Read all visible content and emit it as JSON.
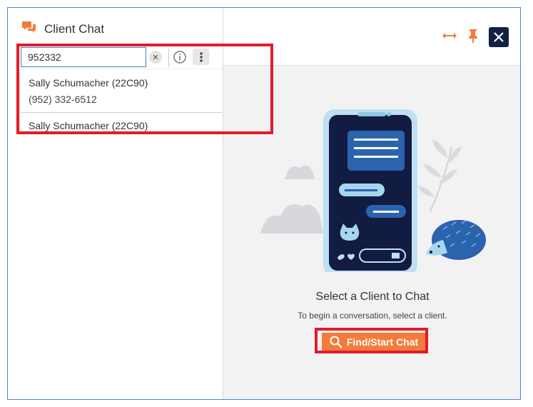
{
  "panel": {
    "title": "Client Chat"
  },
  "search": {
    "value": "952332"
  },
  "results": [
    {
      "name": "Sally Schumacher (22C90)",
      "phone": "(952) 332-6512"
    },
    {
      "name": "Sally Schumacher (22C90)",
      "phone": ""
    }
  ],
  "empty_state": {
    "title": "Select a Client to Chat",
    "subtitle": "To begin a conversation, select a client.",
    "button_label": "Find/Start Chat"
  },
  "icons": {
    "chat": "chat-bubbles-icon",
    "clear": "clear-icon",
    "info": "info-icon",
    "more": "kebab-menu-icon",
    "expand": "expand-horizontal-icon",
    "pin": "pin-icon",
    "close": "close-icon",
    "search": "search-icon"
  },
  "colors": {
    "accent": "#f47b3a",
    "highlight": "#e21c2a",
    "dark": "#142043",
    "border": "#4a86d8"
  }
}
